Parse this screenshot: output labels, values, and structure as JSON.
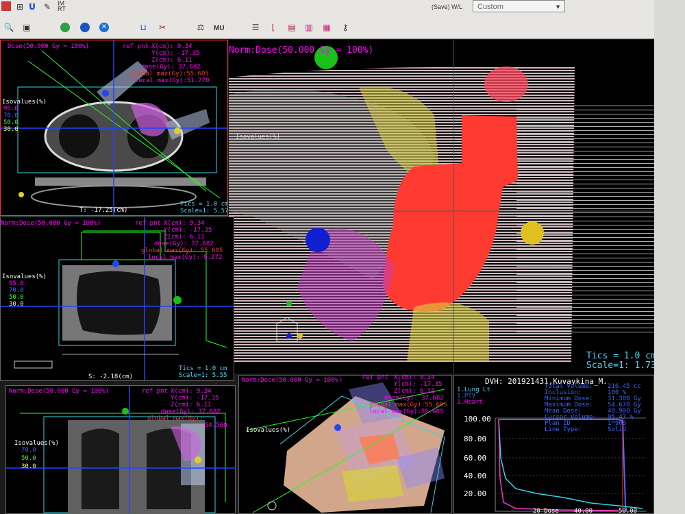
{
  "toolbar": {
    "row1_icons": [
      "image-icon",
      "grid-icon",
      "magnet-icon",
      "wrench-icon",
      "imrt-icon"
    ],
    "imrt_label": "IM\nRT",
    "wl_label": "(Save) W/L",
    "wl_value": "Custom",
    "row2_icons": [
      "zoom-icon",
      "save-icon",
      "globe-green-icon",
      "globe-blue-icon",
      "globe-cross-icon",
      "beam-u-icon",
      "beam-icon",
      "scale-icon",
      "mu-icon",
      "doc-icon",
      "dvh-icon",
      "dose-icon",
      "dose-icon-2",
      "dose-icon-3",
      "lock-icon"
    ],
    "mu_label": "MU"
  },
  "panel_axial": {
    "norm": "Dose(50.000 Gy = 100%)",
    "ref_pnt": "ref pnt",
    "x": "X(cm):  9.34",
    "y": "Y(cm): -17.35",
    "z": "Z(cm):  6.11",
    "dose": "dose(Gy): 37.682",
    "global_max": "global max(Gy):55.605",
    "local_max": "local max(Gy):51.770",
    "isovalues": "Isovalues(%)",
    "iso": [
      "95.0",
      "70.0",
      "50.0",
      "30.0"
    ],
    "slice": "T: -17.25(cm)",
    "tics": "Tics = 1.0 cm",
    "scale": "Scale=1: 5.57"
  },
  "panel_sagittal": {
    "norm": "Norm:Dose(50.000 Gy = 100%)",
    "ref_pnt": "ref pnt",
    "x": "X(cm):  9.34",
    "y": "Y(cm): -17.35",
    "z": "Z(cm):  6.11",
    "dose": "dose(Gy): 37.682",
    "global_max": "global max(Gy): 55.605",
    "local_max": "local max(Gy): 9.272",
    "isovalues": "Isovalues(%)",
    "iso": [
      "95.0",
      "70.0",
      "50.0",
      "30.0"
    ],
    "slice": "S: -2.18(cm)",
    "tics": "Tics = 1.0 cm",
    "scale": "Scale=1: 5.55"
  },
  "panel_coronal": {
    "norm": "Norm:Dose(50.000 Gy = 100%)",
    "ref_pnt": "ref pnt",
    "x": "X(cm):  9.34",
    "y": "Y(cm): -17.35",
    "z": "Z(cm):  6.11",
    "dose": "dose(Gy): 37.682",
    "global_max": "global max(Gy):",
    "local_max": "54.560",
    "isovalues": "Isovalues(%)",
    "iso": [
      "70.0",
      "50.0",
      "30.0"
    ]
  },
  "panel_3d": {
    "norm": "Norm:Dose(50.000 Gy = 100%)",
    "ref_pnt": "ref pnt",
    "x": "X(cm):  9.34",
    "y": "Y(cm): -17.35",
    "z": "Z(cm):  6.11",
    "dose": "dose(Gy): 37.682",
    "global_max": "global max(Gy):55.605",
    "local_max": "local max(Gy):55.605",
    "isovalues": "Isovalues(%)"
  },
  "panel_main": {
    "norm": "Norm:Dose(50.000 Gy = 100%)",
    "isovalues": "Isovalues(%)",
    "tics": "Tics = 1.0 cm",
    "scale": "Scale=1: 1.73"
  },
  "dvh": {
    "title": "DVH: 201921431,Kuvaykina_M.",
    "legend": [
      "1.Lung Lt",
      "1.PTV",
      "1.Heart"
    ],
    "labels": [
      "Total Volume:",
      "Inclusion:",
      "Minimum Dose:",
      "Maximum Dose:",
      "Mean Dose:",
      "Cursor Volume:",
      "Plan ID",
      "Line Type:"
    ],
    "values": [
      "216.45 cc",
      "100 %",
      "31.380 Gy",
      "54.670 Gy",
      "49.900 Gy",
      "95.47 %",
      "1*906",
      "Solid"
    ],
    "yticks": [
      "100.00",
      "80.00",
      "60.00",
      "40.00",
      "20.00"
    ],
    "xlabel": "20 Dose",
    "xticks": [
      "40.00",
      "50.00"
    ],
    "colors": {
      "lung": "#33d6e8",
      "ptv": "#5566ff",
      "heart": "#ff33cc"
    }
  }
}
